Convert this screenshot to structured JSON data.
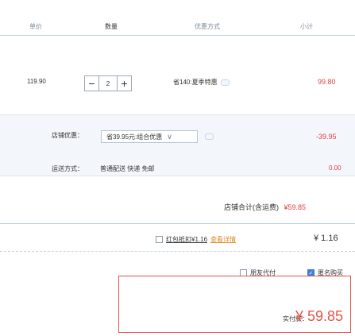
{
  "header": {
    "price": "单价",
    "quantity": "数量",
    "promo": "优惠方式",
    "subtotal": "小计"
  },
  "item": {
    "price": "119.90",
    "quantity": "2",
    "promo_text": "省140:夏季特惠",
    "subtotal": "99.80"
  },
  "shop": {
    "promo_label": "店铺优惠：",
    "coupon_text": "省39.95元:组合优惠",
    "coupon_chevron": "∨",
    "discount": "-39.95",
    "shipping_label": "运送方式：",
    "shipping_method": "普通配送 快递 免邮",
    "shipping_fee": "0.00"
  },
  "total": {
    "label": "店铺合计(含运费)",
    "amount": "¥59.85"
  },
  "redpacket": {
    "label": "红包抵扣¥1.16",
    "link": "查看详情",
    "amount": "¥ 1.16"
  },
  "options": {
    "friend_pay": "朋友代付",
    "anonymous": "匿名购买"
  },
  "final": {
    "label": "实付款：",
    "amount": "¥ 59.85"
  },
  "colors": {
    "accent": "#e5534b",
    "price_red": "#d44",
    "link_orange": "#e08a1f",
    "checkbox_blue": "#3b82d6"
  }
}
